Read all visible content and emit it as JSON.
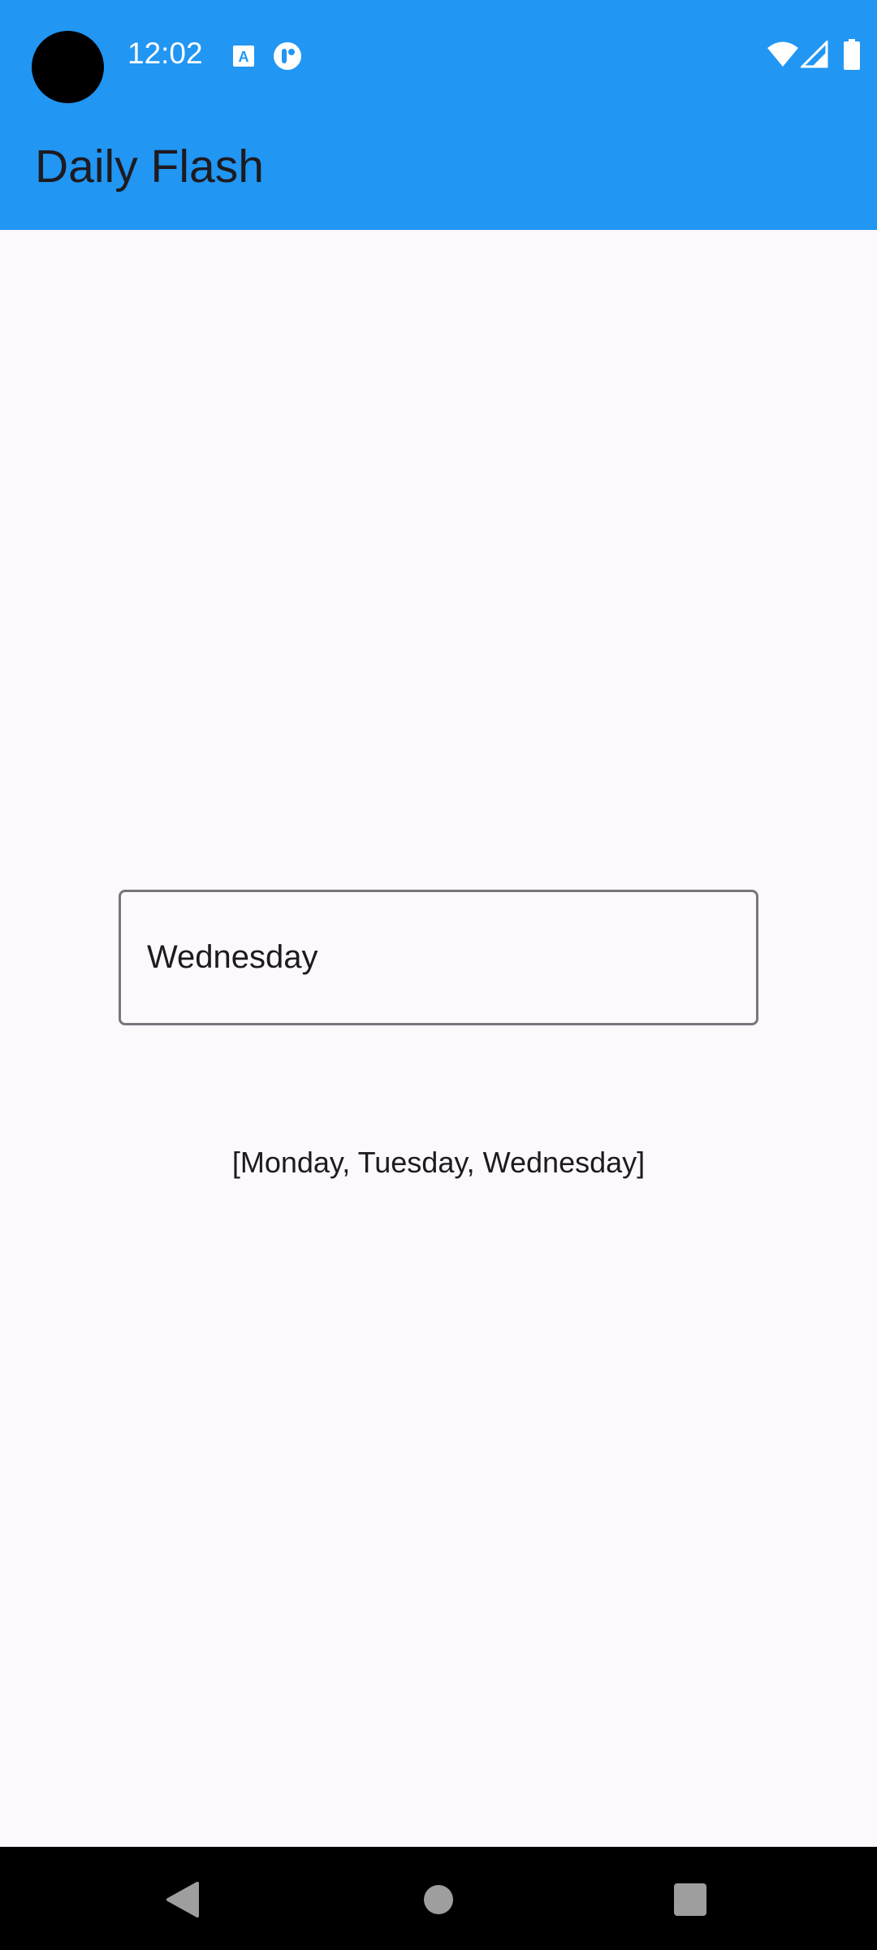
{
  "status_bar": {
    "time": "12:02",
    "icons": [
      "a-icon",
      "circle-icon",
      "wifi-icon",
      "signal-icon",
      "battery-icon"
    ]
  },
  "app_bar": {
    "title": "Daily Flash"
  },
  "main": {
    "day_field_value": "Wednesday",
    "days_list_text": "[Monday, Tuesday, Wednesday]"
  },
  "nav_bar": {
    "buttons": [
      "back",
      "home",
      "recents"
    ]
  },
  "colors": {
    "app_bar": "#2196F3",
    "background": "#FDF8FC",
    "text": "#1D1B20",
    "field_border": "#79747E",
    "nav_bar": "#000000"
  }
}
